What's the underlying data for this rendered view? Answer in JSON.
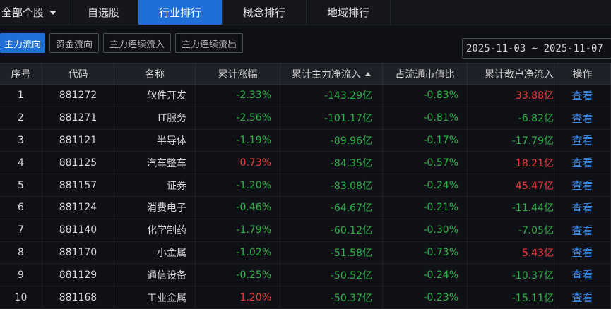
{
  "topnav": {
    "dropdown_label": "全部个股",
    "tabs": [
      {
        "label": "自选股",
        "active": false
      },
      {
        "label": "行业排行",
        "active": true
      },
      {
        "label": "概念排行",
        "active": false
      },
      {
        "label": "地域排行",
        "active": false
      }
    ]
  },
  "filters": {
    "buttons": [
      {
        "label": "主力流向",
        "active": true
      },
      {
        "label": "资金流向",
        "active": false
      },
      {
        "label": "主力连续流入",
        "active": false
      },
      {
        "label": "主力连续流出",
        "active": false
      }
    ],
    "date_range": "2025-11-03 ~ 2025-11-07"
  },
  "table": {
    "columns": [
      "序号",
      "代码",
      "名称",
      "累计涨幅",
      "累计主力净流入",
      "占流通市值比",
      "累计散户净流入",
      "操作"
    ],
    "sorted_column": "累计主力净流入",
    "sort_direction": "asc",
    "action_label": "查看",
    "rows": [
      {
        "index": "1",
        "code": "881272",
        "name": "软件开发",
        "change": "-2.33%",
        "change_color": "green",
        "main_inflow": "-143.29亿",
        "ratio": "-0.83%",
        "retail_inflow": "33.88亿",
        "retail_color": "red"
      },
      {
        "index": "2",
        "code": "881271",
        "name": "IT服务",
        "change": "-2.56%",
        "change_color": "green",
        "main_inflow": "-101.17亿",
        "ratio": "-0.81%",
        "retail_inflow": "-6.82亿",
        "retail_color": "green"
      },
      {
        "index": "3",
        "code": "881121",
        "name": "半导体",
        "change": "-1.19%",
        "change_color": "green",
        "main_inflow": "-89.96亿",
        "ratio": "-0.17%",
        "retail_inflow": "-17.79亿",
        "retail_color": "green"
      },
      {
        "index": "4",
        "code": "881125",
        "name": "汽车整车",
        "change": "0.73%",
        "change_color": "red",
        "main_inflow": "-84.35亿",
        "ratio": "-0.57%",
        "retail_inflow": "18.21亿",
        "retail_color": "red"
      },
      {
        "index": "5",
        "code": "881157",
        "name": "证券",
        "change": "-1.20%",
        "change_color": "green",
        "main_inflow": "-83.08亿",
        "ratio": "-0.24%",
        "retail_inflow": "45.47亿",
        "retail_color": "red"
      },
      {
        "index": "6",
        "code": "881124",
        "name": "消费电子",
        "change": "-0.46%",
        "change_color": "green",
        "main_inflow": "-64.67亿",
        "ratio": "-0.21%",
        "retail_inflow": "-11.44亿",
        "retail_color": "green"
      },
      {
        "index": "7",
        "code": "881140",
        "name": "化学制药",
        "change": "-1.79%",
        "change_color": "green",
        "main_inflow": "-60.12亿",
        "ratio": "-0.30%",
        "retail_inflow": "-7.05亿",
        "retail_color": "green"
      },
      {
        "index": "8",
        "code": "881170",
        "name": "小金属",
        "change": "-1.02%",
        "change_color": "green",
        "main_inflow": "-51.58亿",
        "ratio": "-0.73%",
        "retail_inflow": "5.43亿",
        "retail_color": "red"
      },
      {
        "index": "9",
        "code": "881129",
        "name": "通信设备",
        "change": "-0.25%",
        "change_color": "green",
        "main_inflow": "-50.52亿",
        "ratio": "-0.24%",
        "retail_inflow": "-10.37亿",
        "retail_color": "green"
      },
      {
        "index": "10",
        "code": "881168",
        "name": "工业金属",
        "change": "1.20%",
        "change_color": "red",
        "main_inflow": "-50.37亿",
        "ratio": "-0.23%",
        "retail_inflow": "-15.11亿",
        "retail_color": "green"
      }
    ]
  }
}
